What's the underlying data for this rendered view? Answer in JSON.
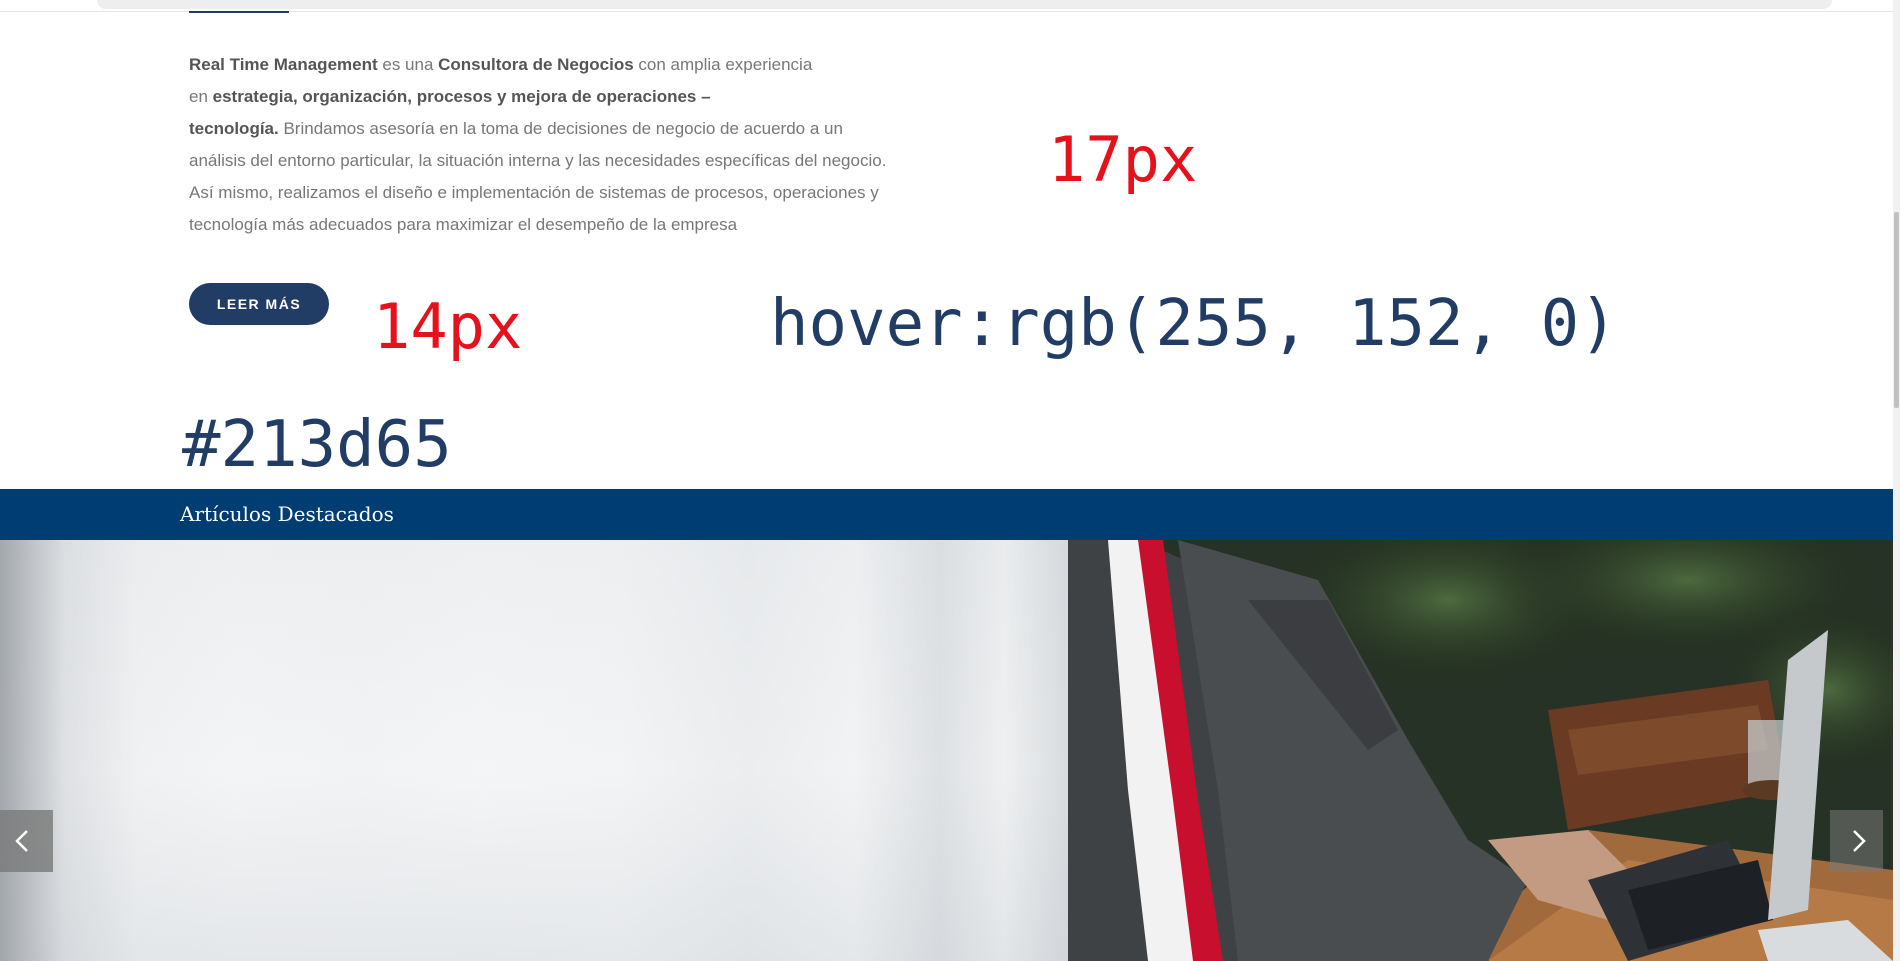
{
  "intro": {
    "brand": "Real Time Management",
    "text1": " es una ",
    "consultora": "Consultora de Negocios",
    "text2": " con amplia experiencia",
    "text3": "en ",
    "areas": "estrategia, organización, procesos y mejora de operaciones –",
    "tecnologia": " tecnología.",
    "text4": " Brindamos asesoría en la toma de decisiones de negocio de acuerdo a un",
    "line4": "análisis del entorno particular, la situación interna y las necesidades específicas del negocio.",
    "line5": "Así mismo, realizamos el diseño e implementación de sistemas de procesos, operaciones y",
    "line6": "tecnología más adecuados para maximizar el desempeño de la empresa"
  },
  "button": {
    "label": "LEER MÁS"
  },
  "annotations": {
    "body_font": "17px",
    "button_font": "14px",
    "hover": "hover:rgb(255, 152, 0)",
    "color": "#213d65"
  },
  "featured": {
    "title": "Artículos Destacados"
  },
  "carousel": {
    "prev_icon": "chevron-left-icon",
    "next_icon": "chevron-right-icon"
  },
  "colors": {
    "primary": "#213d65",
    "hover": "#ff9800",
    "band": "#003d73",
    "annotation_red": "#e5121b"
  }
}
